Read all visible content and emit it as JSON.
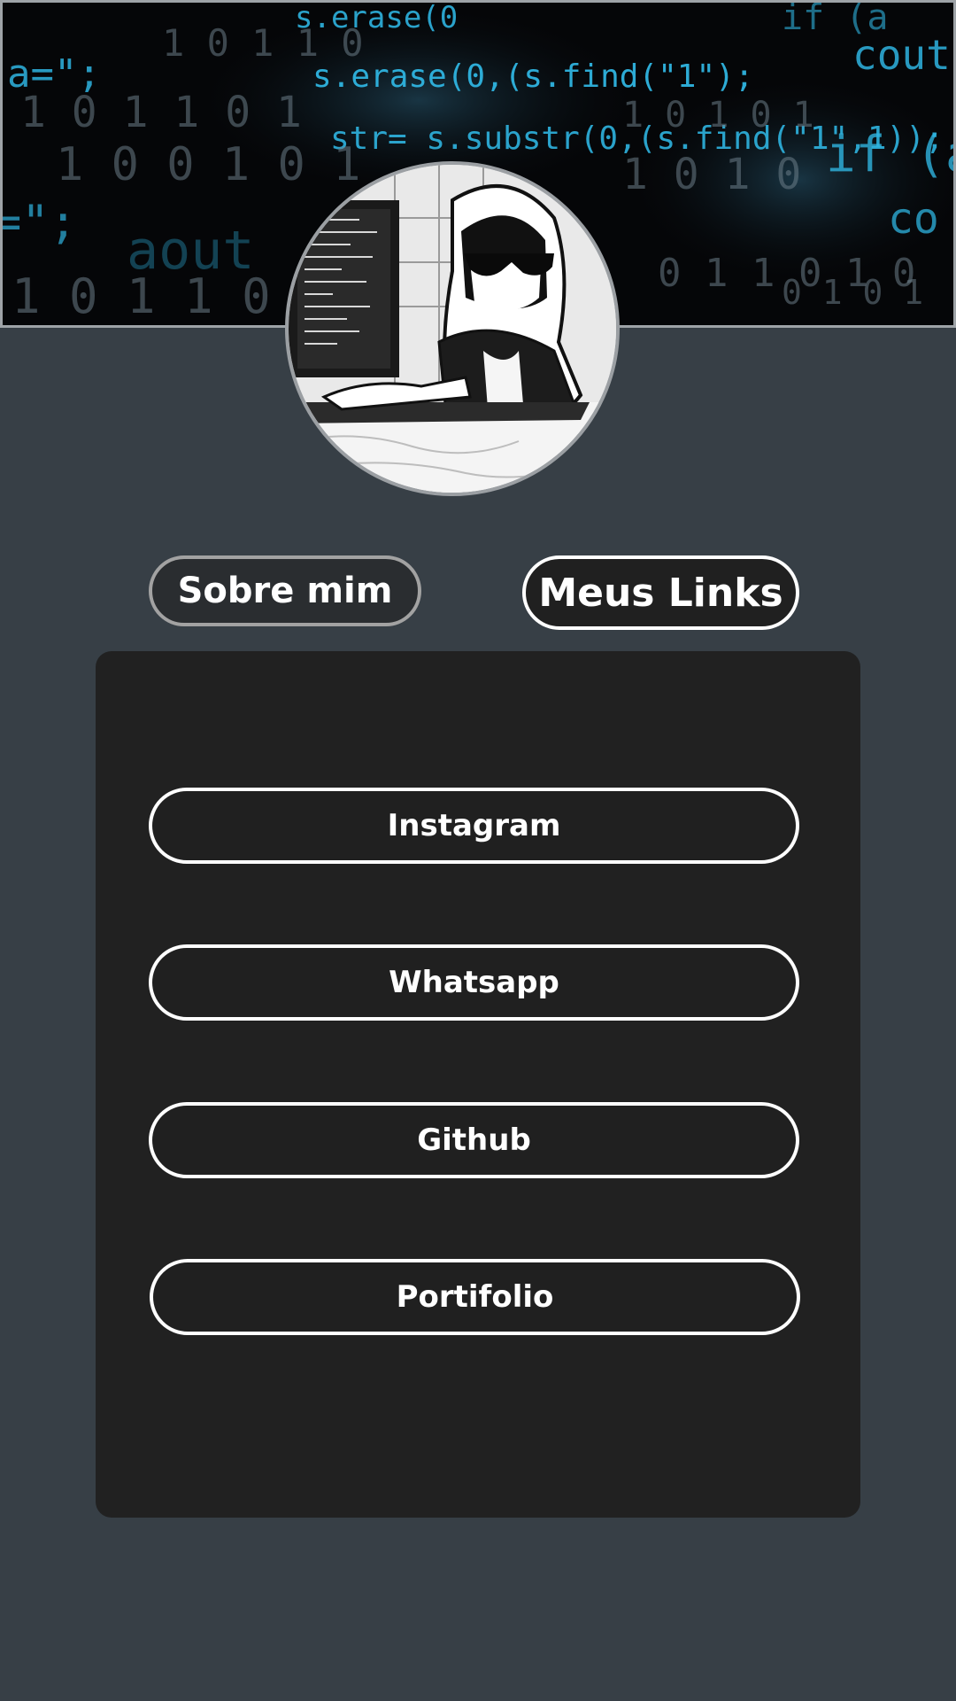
{
  "header": {
    "banner_image": "binary-code-banner",
    "avatar_image": "hooded-coder-avatar"
  },
  "tabs": {
    "about_label": "Sobre mim",
    "links_label": "Meus Links",
    "active": "Meus Links"
  },
  "links": [
    {
      "label": "Instagram"
    },
    {
      "label": "Whatsapp"
    },
    {
      "label": "Github"
    },
    {
      "label": "Portifolio"
    }
  ],
  "colors": {
    "background": "#373f46",
    "card": "#212121",
    "button_border": "#ffffff",
    "banner_accent": "#2fb4e0"
  }
}
